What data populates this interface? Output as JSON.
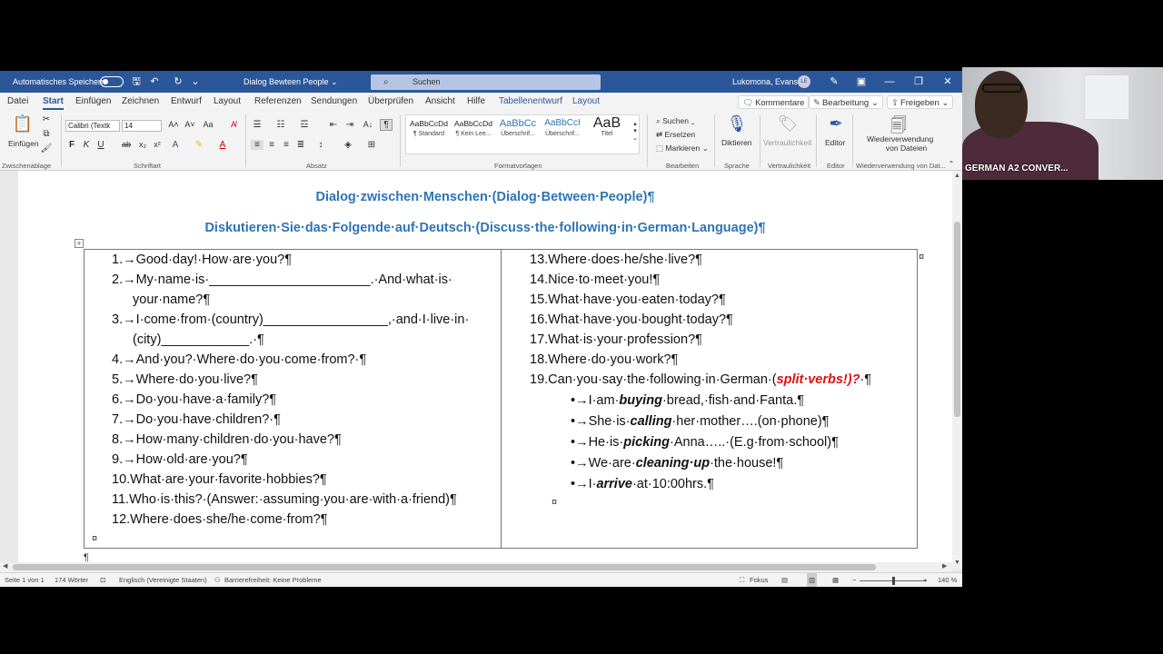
{
  "titlebar": {
    "autosave_label": "Automatisches Speichern",
    "doc_title": "Dialog Bewteen People",
    "search_placeholder": "Suchen",
    "user_name": "Lukomona, Evans",
    "user_initials": "LE"
  },
  "menu": {
    "tabs": [
      "Datei",
      "Start",
      "Einfügen",
      "Zeichnen",
      "Entwurf",
      "Layout",
      "Referenzen",
      "Sendungen",
      "Überprüfen",
      "Ansicht",
      "Hilfe",
      "Tabellenentwurf",
      "Layout"
    ],
    "comments_label": "Kommentare",
    "editing_label": "Bearbeitung",
    "share_label": "Freigeben"
  },
  "ribbon": {
    "paste_label": "Einfügen",
    "clipboard_group": "Zwischenablage",
    "font_name": "Calibri (Textk",
    "font_size": "14",
    "font_group": "Schriftart",
    "paragraph_group": "Absatz",
    "styles": [
      {
        "preview": "AaBbCcDd",
        "name": "¶ Standard"
      },
      {
        "preview": "AaBbCcDd",
        "name": "¶ Kein Lee..."
      },
      {
        "preview": "AaBbCc",
        "name": "Überschrif..."
      },
      {
        "preview": "AaBbCcI",
        "name": "Überschrif..."
      },
      {
        "preview": "AaB",
        "name": "Titel"
      }
    ],
    "styles_group": "Formatvorlagen",
    "find_label": "Suchen",
    "replace_label": "Ersetzen",
    "select_label": "Markieren",
    "editing_group": "Bearbeiten",
    "dictate_label": "Diktieren",
    "voice_group": "Sprache",
    "sensitivity_label": "Vertraulichkeit",
    "sensitivity_group": "Vertraulichkeit",
    "editor_label": "Editor",
    "editor_group": "Editor",
    "reuse_label_1": "Wiederverwendung",
    "reuse_label_2": "von Dateien",
    "reuse_group": "Wiederverwendung von Dat..."
  },
  "document": {
    "heading1": "Dialog·zwischen·Menschen·(Dialog·Between·People)¶",
    "heading2": "Diskutieren·Sie·das·Folgende·auf·Deutsch·(Discuss·the·following·in·German·Language)¶",
    "left_column": [
      "1.→Good·day!·How·are·you?¶",
      "2.→My·name·is·______________________.·And·what·is·",
      "your·name?¶",
      "3.→I·come·from·(country)_________________,·and·I·live·in·",
      "(city)____________.·¶",
      "4.→And·you?·Where·do·you·come·from?·¶",
      "5.→Where·do·you·live?¶",
      "6.→Do·you·have·a·family?¶",
      "7.→Do·you·have·children?·¶",
      "8.→How·many·children·do·you·have?¶",
      "9.→How·old·are·you?¶",
      "10.What·are·your·favorite·hobbies?¶",
      "11.Who·is·this?·(Answer:·assuming·you·are·with·a·friend)¶",
      "12.Where·does·she/he·come·from?¶"
    ],
    "right_column": [
      "13.Where·does·he/she·live?¶",
      "14.Nice·to·meet·you!¶",
      "15.What·have·you·eaten·today?¶",
      "16.What·have·you·bought·today?¶",
      "17.What·is·your·profession?¶",
      "18.Where·do·you·work?¶"
    ],
    "q19_text": "19.Can·you·say·the·following·in·German·(",
    "q19_red": "split·verbs!)?",
    "q19_end": "·¶",
    "bullets": [
      {
        "pre": "•→I·am·",
        "verb": "buying",
        "post": "·bread,·fish·and·Fanta.¶"
      },
      {
        "pre": "•→She·is·",
        "verb": "calling",
        "post": "·her·mother….(on·phone)¶"
      },
      {
        "pre": "•→He·is·",
        "verb": "picking",
        "post": "·Anna…..·(E.g·from·school)¶"
      },
      {
        "pre": "•→We·are·",
        "verb": "cleaning·up",
        "post": "·the·house!¶"
      },
      {
        "pre": "•→I·",
        "verb": "arrive",
        "post": "·at·10:00hrs.¶"
      }
    ],
    "cell_mark": "¤",
    "para_mark": "¶"
  },
  "statusbar": {
    "page": "Seite 1 von 1",
    "words": "174 Wörter",
    "language": "Englisch (Vereinigte Staaten)",
    "accessibility": "Barrierefreiheit: Keine Probleme",
    "focus": "Fokus",
    "zoom": "140 %"
  },
  "webcam": {
    "participant_label": "GERMAN A2 CONVER..."
  },
  "colors": {
    "word_blue": "#2b579a",
    "heading_blue": "#2e74b5",
    "emphasis_red": "#e01010"
  }
}
